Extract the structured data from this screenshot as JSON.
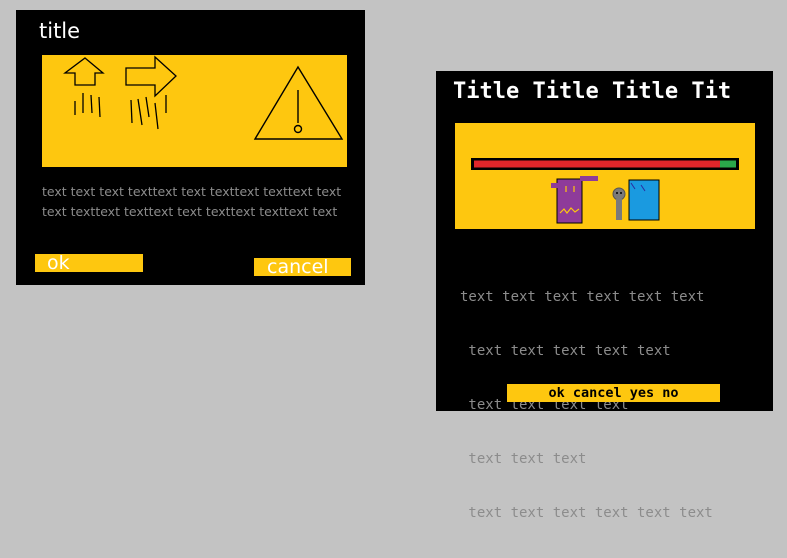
{
  "dialog_left": {
    "title": "title",
    "body_lines": [
      "text text text texttext text texttext texttext text",
      "text texttext texttext text texttext texttext text"
    ],
    "buttons": {
      "ok": "ok",
      "cancel": "cancel"
    },
    "icons": [
      "arrow-up-icon",
      "arrow-right-icon",
      "warning-icon"
    ]
  },
  "dialog_right": {
    "title": "Title Title Title Tit",
    "progress": 0.94,
    "body_lines": [
      "text text text text text text",
      " text text text text text",
      " text text text text",
      " text text text",
      " text text text text text text"
    ],
    "button_label": "ok cancel yes no",
    "icons": [
      "purple-character-icon",
      "gray-figure-icon",
      "blue-character-icon"
    ]
  },
  "colors": {
    "background": "#c3c3c3",
    "dialog": "#000000",
    "accent": "#fec70f",
    "muted_text": "#8c8c8c",
    "progress_red": "#e0262a",
    "progress_green": "#2aa84a"
  }
}
